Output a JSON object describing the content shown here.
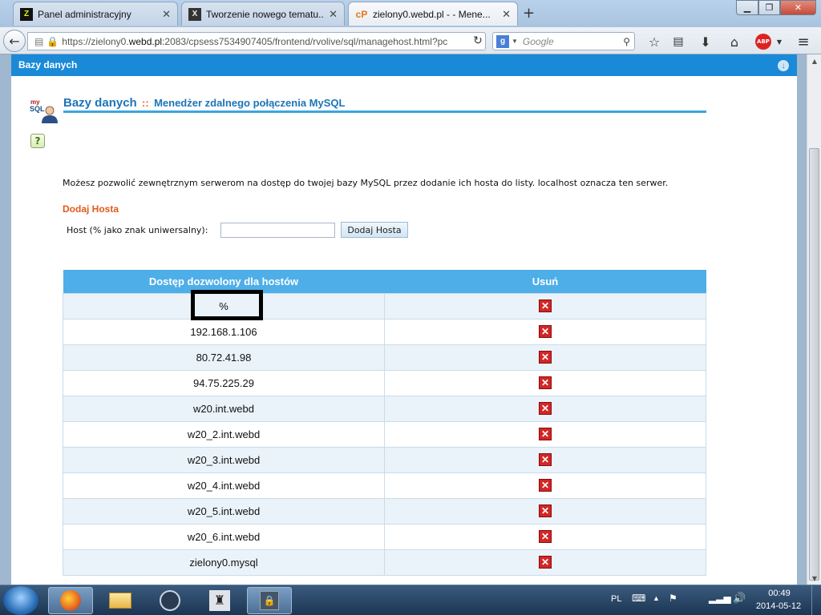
{
  "browser": {
    "tabs": [
      {
        "title": "Panel administracyjny",
        "favicon": "Z",
        "active": false
      },
      {
        "title": "Tworzenie nowego tematu...",
        "favicon": "X",
        "active": false
      },
      {
        "title": "zielony0.webd.pl - - Mene...",
        "favicon": "cP",
        "active": true
      }
    ],
    "url_prefix": "https://zielony0.",
    "url_domain": "webd.pl",
    "url_rest": ":2083/cpsess7534907405/frontend/rvolive/sql/managehost.html?pc",
    "search_placeholder": "Google"
  },
  "panel": {
    "header": "Bazy danych",
    "title": "Bazy danych",
    "separator": "::",
    "subtitle": "Menedżer zdalnego połączenia MySQL",
    "description": "Możesz pozwolić zewnętrznym serwerom na dostęp do twojej bazy MySQL przez dodanie ich hosta do listy. localhost oznacza ten serwer.",
    "add_title": "Dodaj Hosta",
    "host_label": "Host (% jako znak uniwersalny):",
    "host_value": "",
    "add_button": "Dodaj Hosta"
  },
  "table": {
    "col_host": "Dostęp dozwolony dla hostów",
    "col_delete": "Usuń",
    "rows": [
      {
        "host": "%"
      },
      {
        "host": "192.168.1.106"
      },
      {
        "host": "80.72.41.98"
      },
      {
        "host": "94.75.225.29"
      },
      {
        "host": "w20.int.webd"
      },
      {
        "host": "w20_2.int.webd"
      },
      {
        "host": "w20_3.int.webd"
      },
      {
        "host": "w20_4.int.webd"
      },
      {
        "host": "w20_5.int.webd"
      },
      {
        "host": "w20_6.int.webd"
      },
      {
        "host": "zielony0.mysql"
      }
    ]
  },
  "taskbar": {
    "language": "PL",
    "time": "00:49",
    "date": "2014-05-12"
  },
  "colors": {
    "accent": "#1a8ad8",
    "table_header": "#4eaee8",
    "orange": "#e05a1a",
    "delete_red": "#d32626"
  }
}
